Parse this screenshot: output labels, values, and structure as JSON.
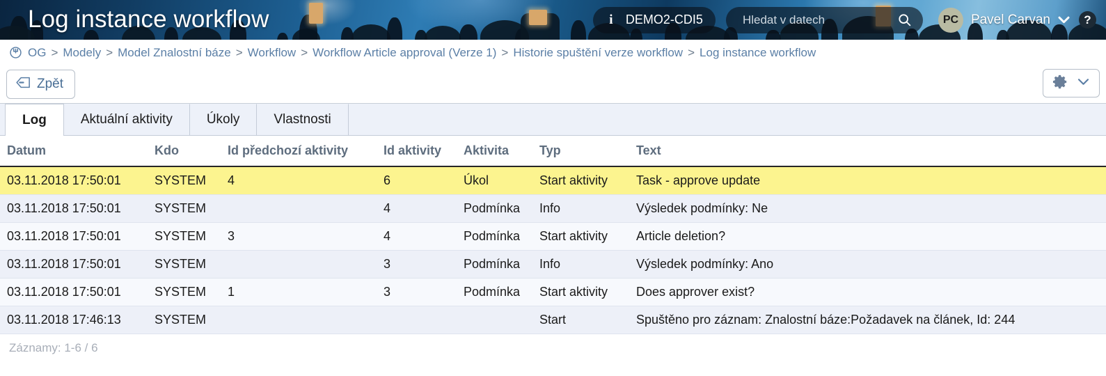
{
  "header": {
    "title": "Log instance workflow",
    "environment": {
      "icon": "info-icon",
      "label": "DEMO2-CDI5"
    },
    "search": {
      "placeholder": "Hledat v datech",
      "value": "",
      "icon": "search-icon"
    },
    "user": {
      "initials": "PC",
      "name": "Pavel Carvan",
      "caret_icon": "chevron-down-icon"
    },
    "help": {
      "icon": "help-icon",
      "label": "?"
    }
  },
  "breadcrumb": {
    "home_icon": "power-home-icon",
    "separator": ">",
    "items": [
      {
        "label": "OG"
      },
      {
        "label": "Modely"
      },
      {
        "label": "Model Znalostní báze"
      },
      {
        "label": "Workflow"
      },
      {
        "label": "Workflow Article approval (Verze 1)"
      },
      {
        "label": "Historie spuštění verze workflow"
      },
      {
        "label": "Log instance workflow"
      }
    ]
  },
  "toolbar": {
    "back_label": "Zpět",
    "back_icon": "back-arrow-icon",
    "settings_icon": "gear-icon",
    "settings_caret_icon": "chevron-down-icon"
  },
  "tabs": [
    {
      "label": "Log",
      "active": true
    },
    {
      "label": "Aktuální aktivity",
      "active": false
    },
    {
      "label": "Úkoly",
      "active": false
    },
    {
      "label": "Vlastnosti",
      "active": false
    }
  ],
  "table": {
    "columns": [
      "Datum",
      "Kdo",
      "Id předchozí aktivity",
      "Id aktivity",
      "Aktivita",
      "Typ",
      "Text"
    ],
    "rows": [
      {
        "datum": "03.11.2018 17:50:01",
        "kdo": "SYSTEM",
        "id_predchozi_aktivity": "4",
        "id_aktivity": "6",
        "aktivita": "Úkol",
        "typ": "Start aktivity",
        "text": "Task - approve update",
        "selected": true
      },
      {
        "datum": "03.11.2018 17:50:01",
        "kdo": "SYSTEM",
        "id_predchozi_aktivity": "",
        "id_aktivity": "4",
        "aktivita": "Podmínka",
        "typ": "Info",
        "text": "Výsledek podmínky: Ne",
        "selected": false
      },
      {
        "datum": "03.11.2018 17:50:01",
        "kdo": "SYSTEM",
        "id_predchozi_aktivity": "3",
        "id_aktivity": "4",
        "aktivita": "Podmínka",
        "typ": "Start aktivity",
        "text": "Article deletion?",
        "selected": false
      },
      {
        "datum": "03.11.2018 17:50:01",
        "kdo": "SYSTEM",
        "id_predchozi_aktivity": "",
        "id_aktivity": "3",
        "aktivita": "Podmínka",
        "typ": "Info",
        "text": "Výsledek podmínky: Ano",
        "selected": false
      },
      {
        "datum": "03.11.2018 17:50:01",
        "kdo": "SYSTEM",
        "id_predchozi_aktivity": "1",
        "id_aktivity": "3",
        "aktivita": "Podmínka",
        "typ": "Start aktivity",
        "text": "Does approver exist?",
        "selected": false
      },
      {
        "datum": "03.11.2018 17:46:13",
        "kdo": "SYSTEM",
        "id_predchozi_aktivity": "",
        "id_aktivity": "",
        "aktivita": "",
        "typ": "Start",
        "text": "Spuštěno pro záznam: Znalostní báze:Požadavek na článek, Id: 244",
        "selected": false
      }
    ],
    "record_count_label": "Záznamy: 1-6 / 6"
  },
  "colors": {
    "selected_row": "#fcf48f",
    "row_alt": "#edf0f8",
    "row_base": "#f7f9fd",
    "link": "#5b7fa6",
    "header_text": "#5e6d7e"
  }
}
